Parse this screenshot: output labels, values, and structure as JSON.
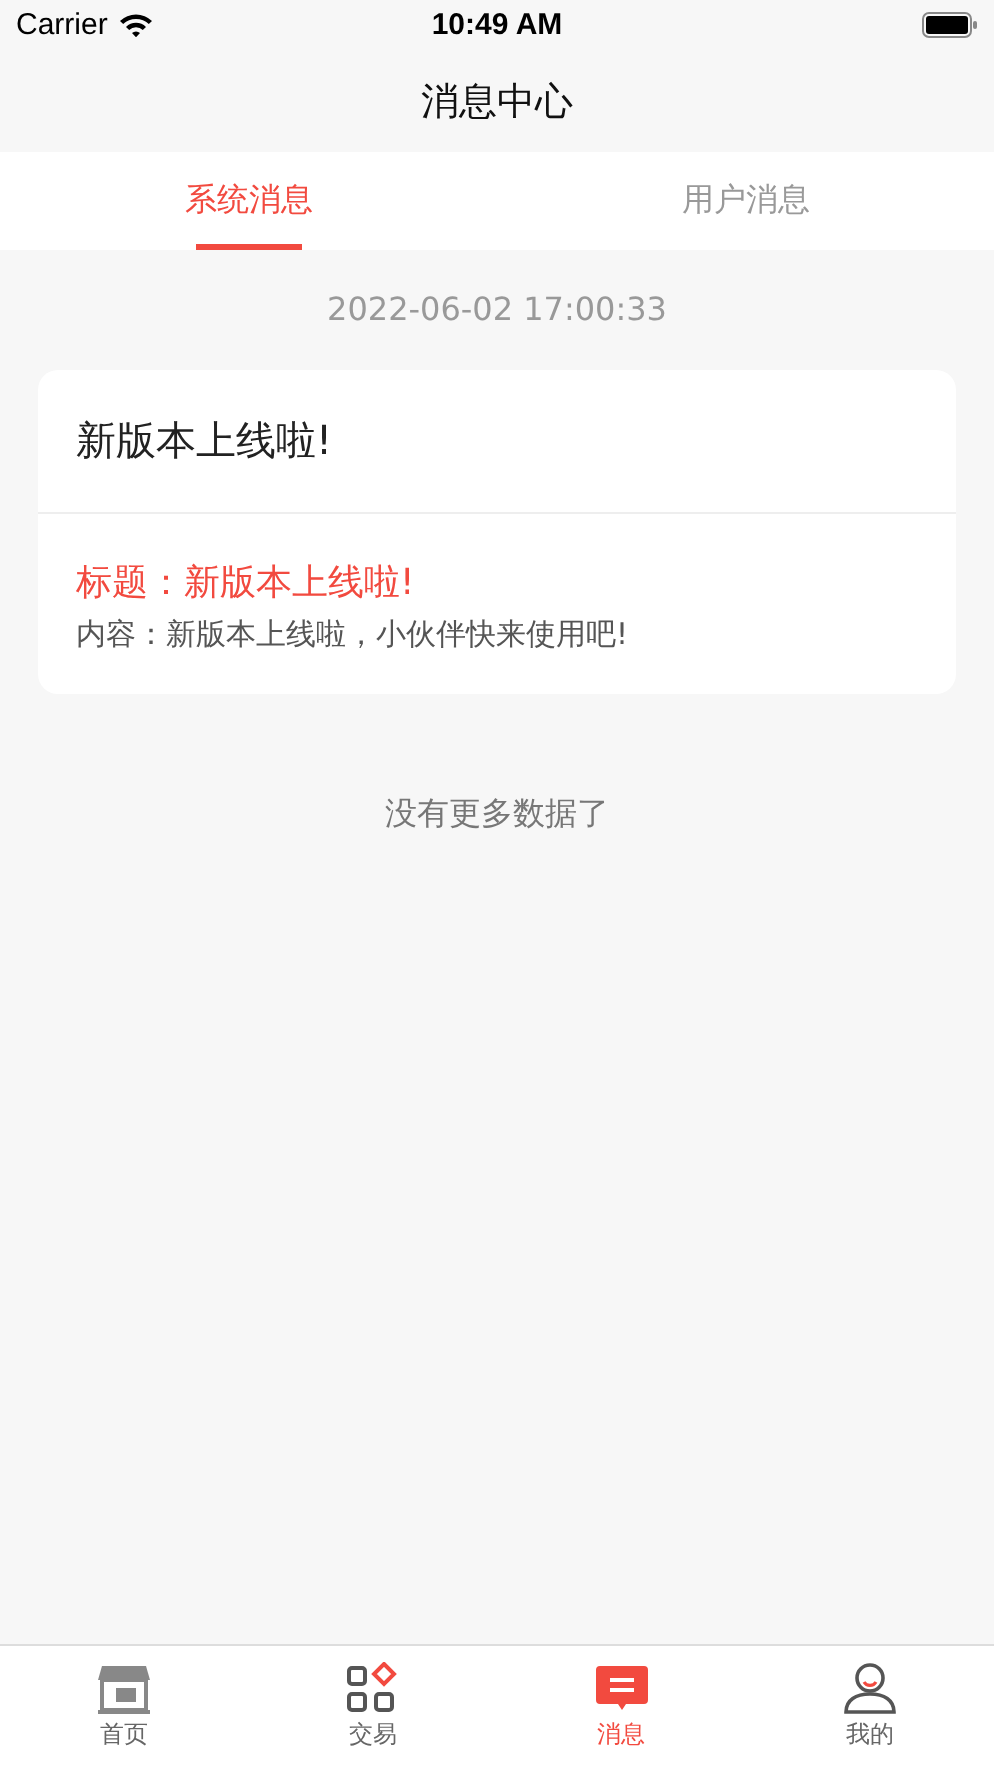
{
  "status_bar": {
    "carrier": "Carrier",
    "time": "10:49 AM"
  },
  "nav": {
    "title": "消息中心"
  },
  "tabs": [
    {
      "label": "系统消息",
      "selected": true
    },
    {
      "label": "用户消息",
      "selected": false
    }
  ],
  "messages": [
    {
      "date": "2022-06-02 17:00:33",
      "title": "新版本上线啦!",
      "heading": "标题：新版本上线啦!",
      "body": "内容：新版本上线啦，小伙伴快来使用吧!"
    }
  ],
  "footer_note": "没有更多数据了",
  "tab_bar": [
    {
      "kind": "shop",
      "label": "首页",
      "selected": false
    },
    {
      "kind": "grid",
      "label": "交易",
      "selected": false
    },
    {
      "kind": "message",
      "label": "消息",
      "selected": true
    },
    {
      "kind": "user",
      "label": "我的",
      "selected": false
    }
  ]
}
